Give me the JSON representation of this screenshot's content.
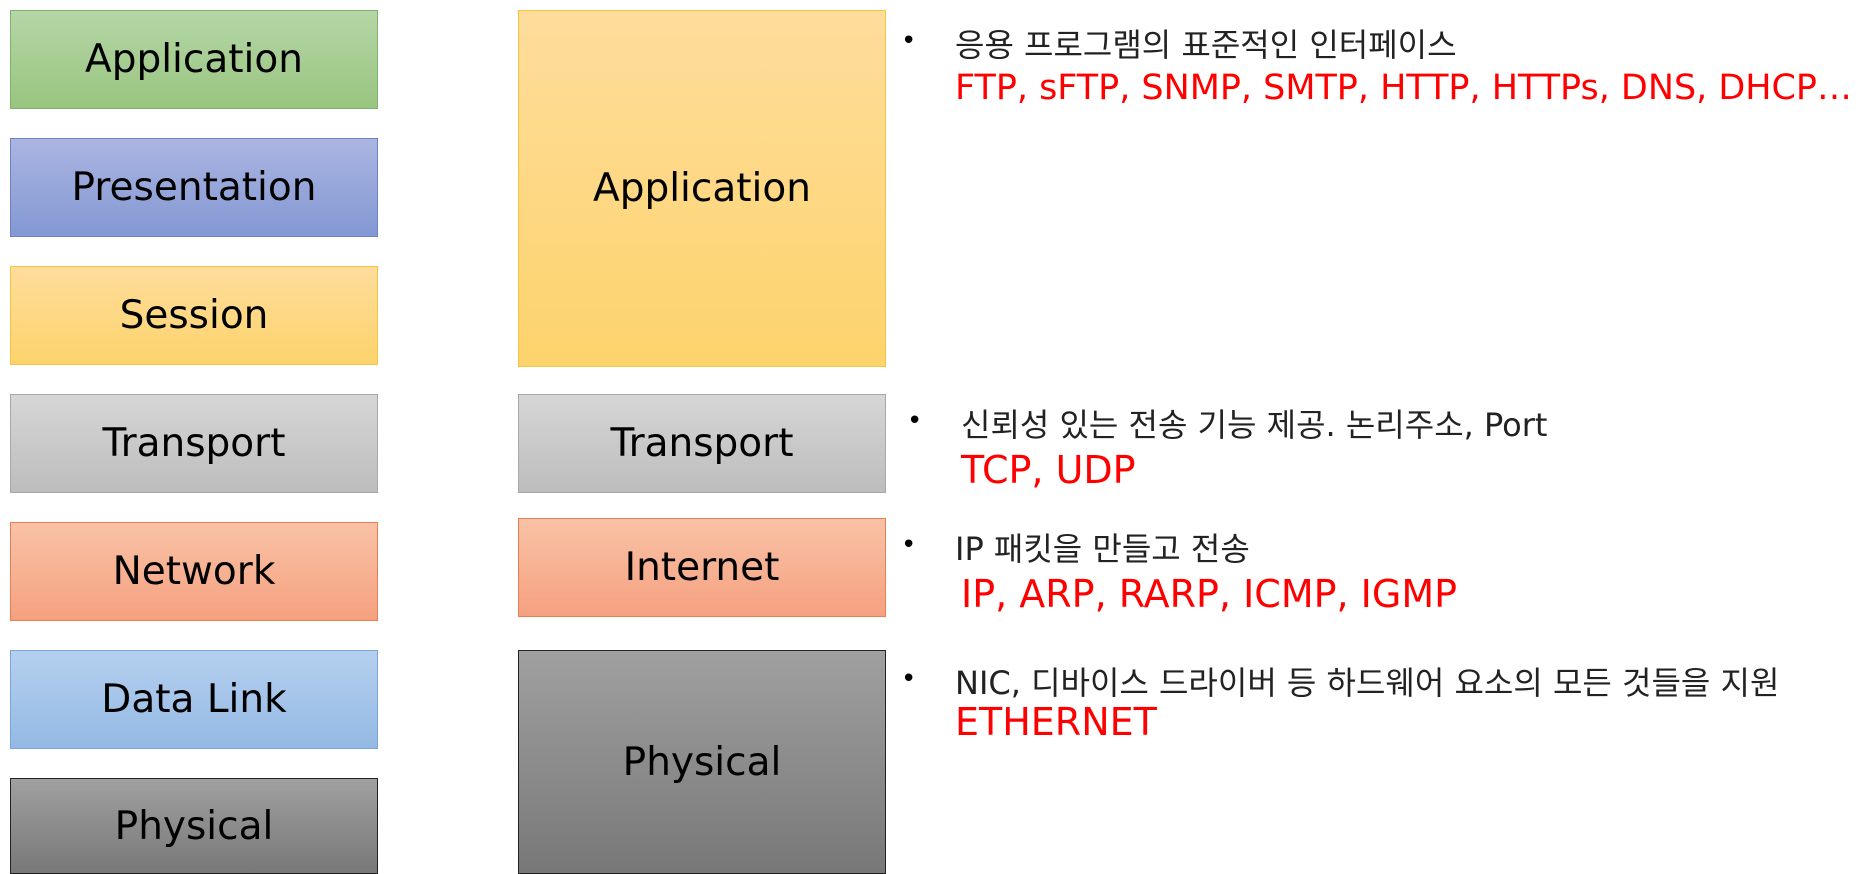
{
  "osi_layers": [
    "Application",
    "Presentation",
    "Session",
    "Transport",
    "Network",
    "Data Link",
    "Physical"
  ],
  "tcpip_layers": [
    "Application",
    "Transport",
    "Internet",
    "Physical"
  ],
  "bullet_symbol": "•",
  "descriptions": [
    {
      "text": "응용 프로그램의 표준적인 인터페이스",
      "protocols": "FTP, sFTP, SNMP, SMTP, HTTP, HTTPs, DNS, DHCP…"
    },
    {
      "text": "신뢰성 있는 전송 기능 제공. 논리주소, Port",
      "protocols": "TCP, UDP"
    },
    {
      "text": "IP 패킷을 만들고 전송",
      "protocols": "IP, ARP, RARP, ICMP, IGMP"
    },
    {
      "text": "NIC, 디바이스 드라이버 등 하드웨어 요소의 모든 것들을 지원",
      "protocols": "ETHERNET"
    }
  ],
  "colors": {
    "protocol_text": "#ff0000",
    "application_green": "#9fca8a",
    "presentation_blue": "#8fa2d8",
    "session_yellow": "#fdd77d",
    "transport_gray": "#c8c8c8",
    "network_orange": "#f6ac8c",
    "datalink_blue": "#9fc1e8",
    "physical_gray": "#8a8a8a"
  }
}
